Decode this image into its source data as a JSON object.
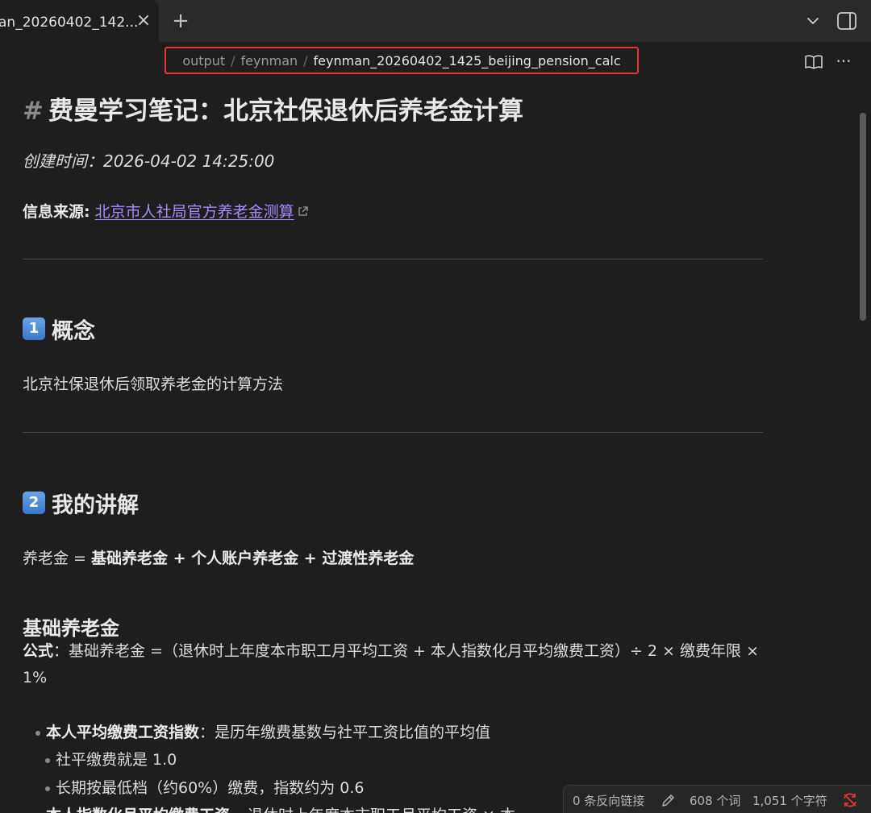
{
  "tab": {
    "title": "an_20260402_142...",
    "close_glyph": "×",
    "new_tab_glyph": "+"
  },
  "breadcrumb": {
    "items": [
      "output",
      "feynman"
    ],
    "current": "feynman_20260402_1425_beijing_pension_calc",
    "separator": "/"
  },
  "header_icons": {
    "reading": "book-open-icon",
    "more": "more-options-icon",
    "more_glyph": "···"
  },
  "doc": {
    "h1_hash": "#",
    "title": "费曼学习笔记：北京社保退休后养老金计算",
    "created": "创建时间：2026-04-02 14:25:00",
    "source_label": "信息来源:",
    "source_link": "北京市人社局官方养老金测算",
    "section1": {
      "num": "1",
      "title": "概念",
      "text": "北京社保退休后领取养老金的计算方法"
    },
    "section2": {
      "num": "2",
      "title": "我的讲解",
      "equation": {
        "lead": "养老金 = ",
        "part1": "基础养老金",
        "plus1": " + ",
        "part2": "个人账户养老金",
        "plus2": " + ",
        "part3": "过渡性养老金"
      },
      "sub_heading": "基础养老金",
      "formula_label": "公式",
      "formula_text": "：基础养老金 =（退休时上年度本市职工月平均工资 + 本人指数化月平均缴费工资）÷ 2 × 缴费年限 × 1%",
      "bullets": [
        {
          "bold": "本人平均缴费工资指数",
          "text": "：是历年缴费基数与社平工资比值的平均值"
        },
        {
          "bold": "",
          "text": "社平缴费就是 1.0"
        },
        {
          "bold": "",
          "text": "长期按最低档（约60%）缴费，指数约为 0.6"
        },
        {
          "bold": "本人指数化月平均缴费工资",
          "text": "= 退休时上年度本市职工月平均工资 × 本"
        }
      ]
    }
  },
  "status": {
    "backlinks": "0 条反向链接",
    "words": "608 个词",
    "chars": "1,051 个字符"
  },
  "colors": {
    "accent_link": "#a88bfa",
    "highlight_border": "#e0383b",
    "sync_error": "#e0383b"
  }
}
